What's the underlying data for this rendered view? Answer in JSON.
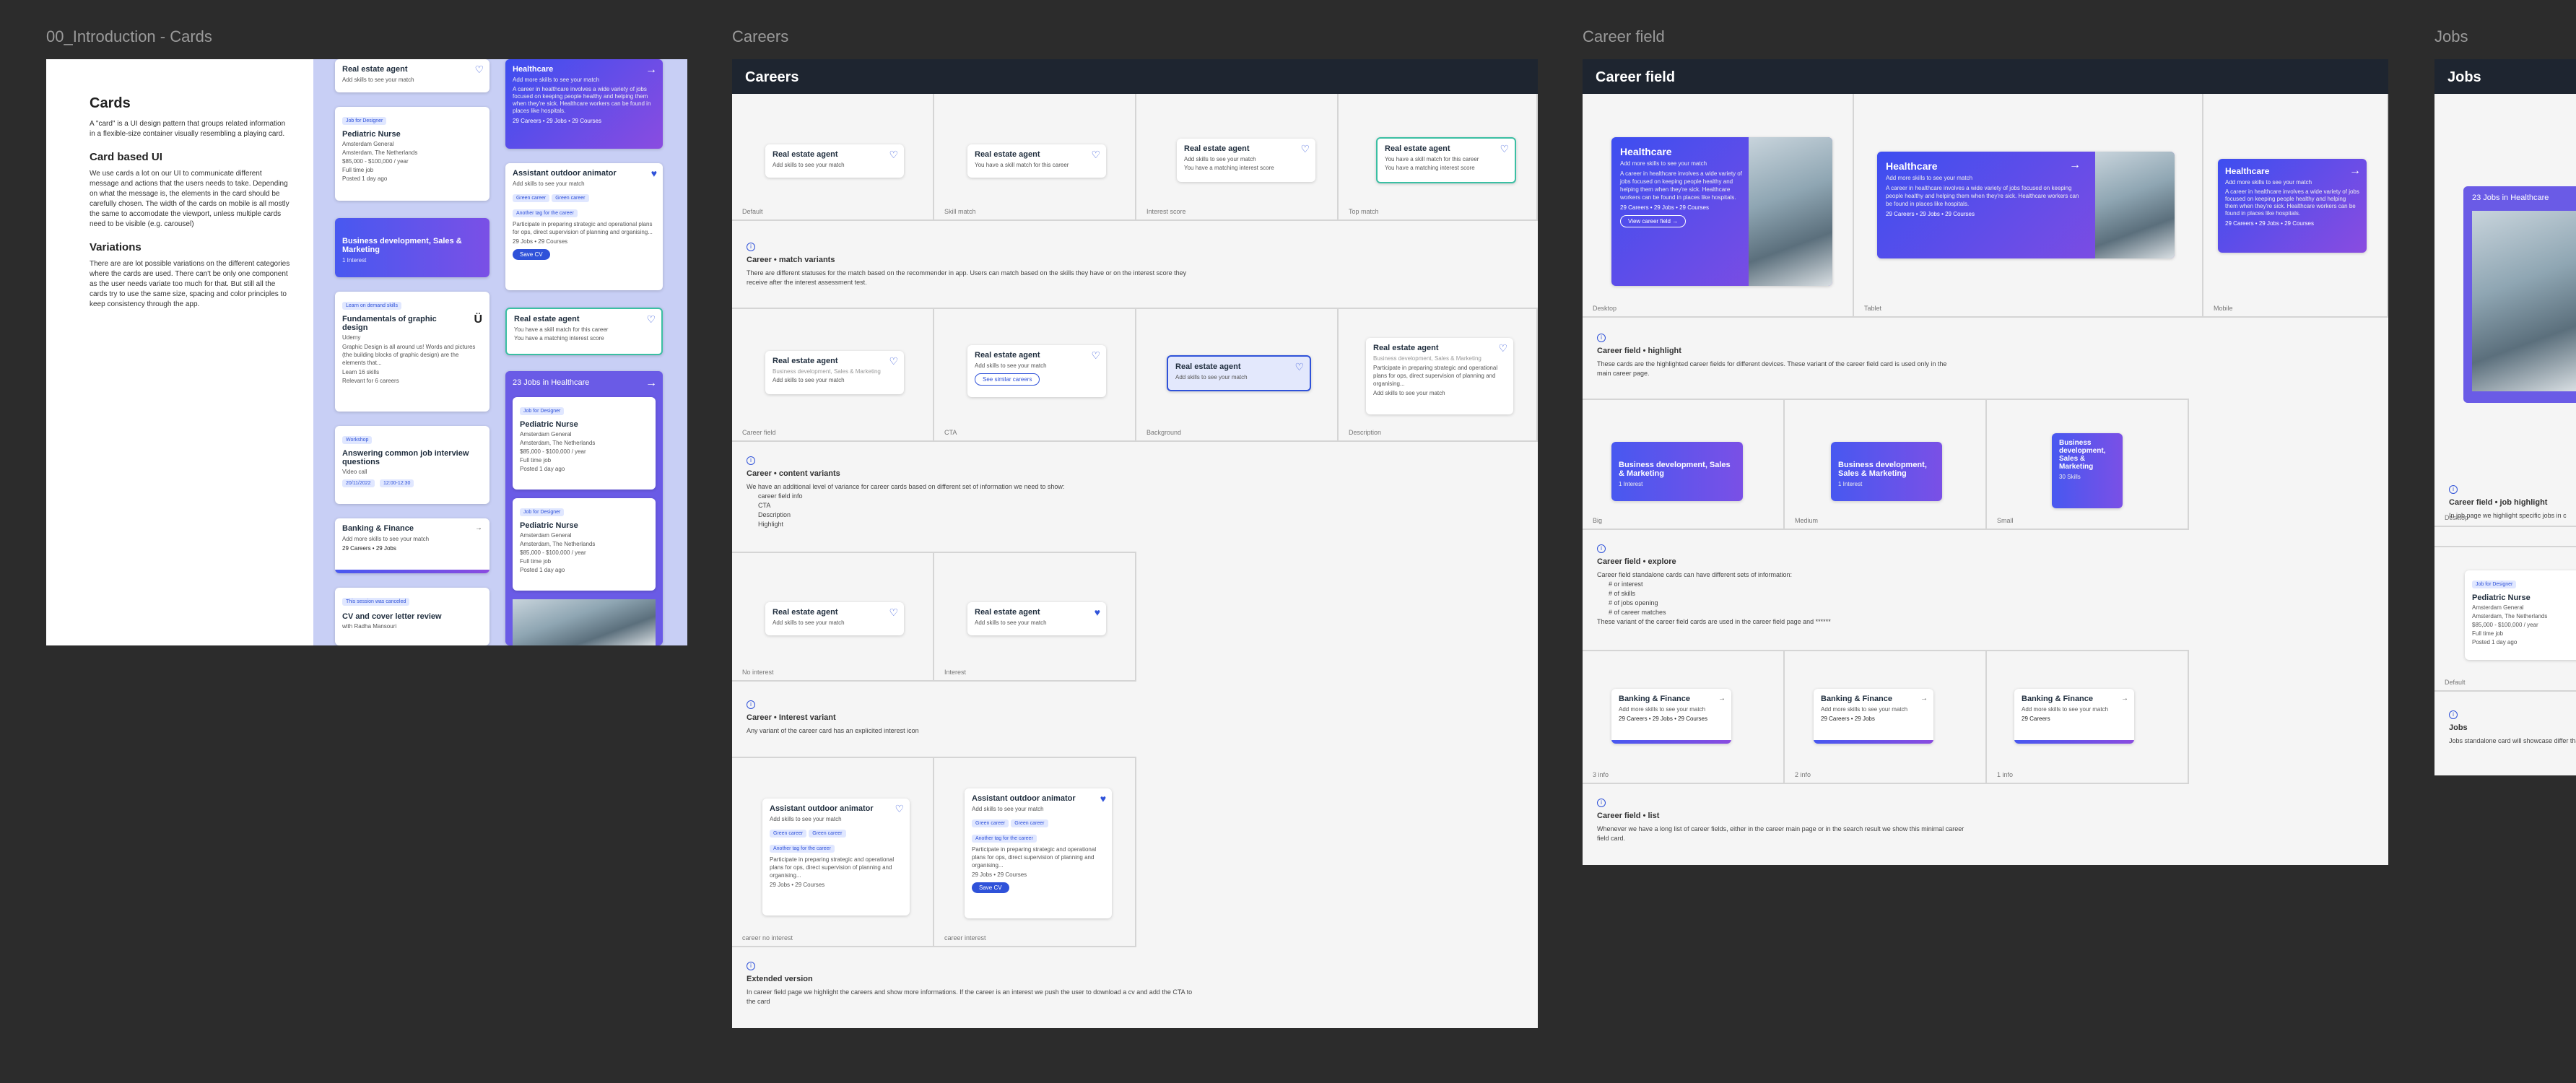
{
  "frames": {
    "intro": "00_Introduction - Cards",
    "careers": "Careers",
    "career_field": "Career field",
    "jobs": "Jobs"
  },
  "intro": {
    "title": "Cards",
    "p1": "A \"card\" is a UI design pattern that groups related information in a flexible-size container visually resembling a playing card.",
    "h2": "Card based UI",
    "p2": "We use cards a lot on our UI to communicate different message and actions that the users needs to take. Depending on what the message is, the elements in the card should be carefully chosen. The width of the cards on mobile is all mostly the same to accomodate the viewport, unless multiple cards need to be visible (e.g. carousel)",
    "h3": "Variations",
    "p3": "There are are lot possible variations on the different categories where the cards are used. There can't be only one component as the user needs variate too much for that. But still all the cards try to use the same size, spacing and color principles to keep consistency through the app."
  },
  "common": {
    "real_estate": "Real estate agent",
    "add_skills": "Add skills to see your match",
    "skill_match": "You have a skill match for this career",
    "interest_score": "You have a matching interest score",
    "healthcare": "Healthcare",
    "add_more_skills": "Add more skills to see your match",
    "health_desc": "A career in healthcare involves a wide variety of jobs focused on keeping people healthy and helping them when they're sick. Healthcare workers can be found in places like hospitals.",
    "health_stats": "29 Careers • 29 Jobs • 29 Courses",
    "view_field": "View career field →",
    "assistant": "Assistant outdoor animator",
    "green_career": "Green career",
    "another_tag": "Another tag for the career",
    "participate": "Participate in preparing strategic and operational plans for ops, direct supervision of planning and organising...",
    "jobs_courses": "29 Jobs • 29 Courses",
    "save_cv": "Save CV",
    "banking": "Banking & Finance",
    "banking_stats": "29 Careers • 29 Jobs • 29 Courses",
    "banking_stats2": "29 Careers • 29 Jobs",
    "banking_stats3": "29 Careers",
    "business": "Business development, Sales & Marketing",
    "one_interest": "1 Interest",
    "skills30": "30 Skills",
    "job_for": "Job for Designer",
    "pediatric": "Pediatric Nurse",
    "amsterdam_general": "Amsterdam General",
    "amsterdam_nl": "Amsterdam, The Netherlands",
    "salary": "$85,000 - $100,000 / year",
    "full_time": "Full time job",
    "posted": "Posted 1 day ago",
    "jobs_in": "23 Jobs in Healthcare",
    "see_similar": "See similar careers",
    "business_sub": "Business development, Sales & Marketing"
  },
  "intro_cards": {
    "learn": "Learn on demand skills",
    "graphic": "Fundamentals of graphic design",
    "udemy": "Udemy",
    "graphic_desc": "Graphic Design is all around us! Words and pictures (the building blocks of graphic design) are the elements that...",
    "learn_skills": "Learn 16 skills",
    "relevant": "Relevant for 6 careers",
    "workshop": "Workshop",
    "answering": "Answering common job interview questions",
    "video_call": "Video call",
    "date": "20/11/2022",
    "time": "12:00-12:30",
    "canceled": "This session was canceled",
    "cv_review": "CV and cover letter review",
    "with": "with Radha Mansouri"
  },
  "careers": {
    "captions": [
      "Default",
      "Skill match",
      "Interest score",
      "Top match",
      "Career field",
      "CTA",
      "Background",
      "Description",
      "No interest",
      "Interest",
      "career no interest",
      "career interest"
    ],
    "match_title": "Career • match variants",
    "match_desc": "There are different statuses for the match based on the recommender in app. Users can match based on the skills they have or on the interest score they receive after the interest assessment test.",
    "content_title": "Career • content variants",
    "content_desc": "We have an additional level of variance for career cards based on different set of information we need to show:",
    "content_list": [
      "career field info",
      "CTA",
      "Description",
      "Highlight"
    ],
    "interest_title": "Career • Interest variant",
    "interest_desc": "Any variant of the career card has an explicited interest icon",
    "extended_title": "Extended version",
    "extended_desc": "In career field page we highlight the careers and show more informations. If the career is an interest we push the user to download a cv and add the CTA to the card"
  },
  "career_field": {
    "captions": [
      "Desktop",
      "Tablet",
      "Mobile",
      "Big",
      "Medium",
      "Small",
      "3 info",
      "2 info",
      "1 info"
    ],
    "highlight_title": "Career field • highlight",
    "highlight_desc": "These cards are the highlighted career fields for different devices. These variant of the career field card is used only in the main career page.",
    "explore_title": "Career field • explore",
    "explore_desc": "Career field standalone cards can have different sets of information:",
    "explore_list": [
      "# or interest",
      "# of skills",
      "# of jobs opening",
      "# of career matches"
    ],
    "explore_tail": "These variant of the career field cards are used in the career field page and ******",
    "list_title": "Career field • list",
    "list_desc": "Whenever we have a long list of career fields, either in the career main page or in the search result we show this minimal career field card."
  },
  "jobs": {
    "caption_desktop": "Desktop",
    "caption_default": "Default",
    "highlight_title": "Career field • job highlight",
    "highlight_desc": "In job page we highlight specific jobs in c",
    "jobs_title": "Jobs",
    "jobs_desc": "Jobs standalone card will showcase differ that might be missing. In that case we p"
  }
}
